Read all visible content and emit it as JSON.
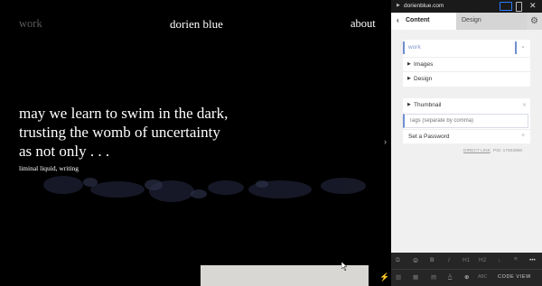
{
  "site": {
    "nav_work": "work",
    "title": "dorien blue",
    "nav_about": "about",
    "hero_lines": [
      "may we learn to swim in the dark,",
      "trusting the womb of uncertainty",
      "as not only . . ."
    ],
    "hero_tags": "liminal liquid, writing",
    "expand_icon": "chevron-right-icon",
    "bolt_icon": "lightning-icon"
  },
  "panel": {
    "url": "dorienblue.com",
    "tabs": {
      "content": "Content",
      "design": "Design"
    },
    "page_select_value": "work",
    "sections": {
      "images": "Images",
      "design": "Design",
      "thumbnail": "Thumbnail"
    },
    "tags_placeholder": "Tags (separate by comma)",
    "set_password": "Set a Password",
    "direct_link": "DIRECT LINK",
    "pid": "PID: 17903986",
    "code_view": "CODE VIEW",
    "toolbar_row1": [
      "⧉",
      "☺",
      "B",
      "I",
      "H1",
      "H2",
      "↓",
      "≡",
      "•••"
    ],
    "toolbar_row2": [
      "▥",
      "▦",
      "▤",
      "A",
      "⊕",
      "ABC"
    ]
  },
  "colors": {
    "accent": "#6f8fd0",
    "site_bg": "#000000",
    "panel_bg": "#f0f0f0",
    "toolbar_bg": "#262626"
  }
}
